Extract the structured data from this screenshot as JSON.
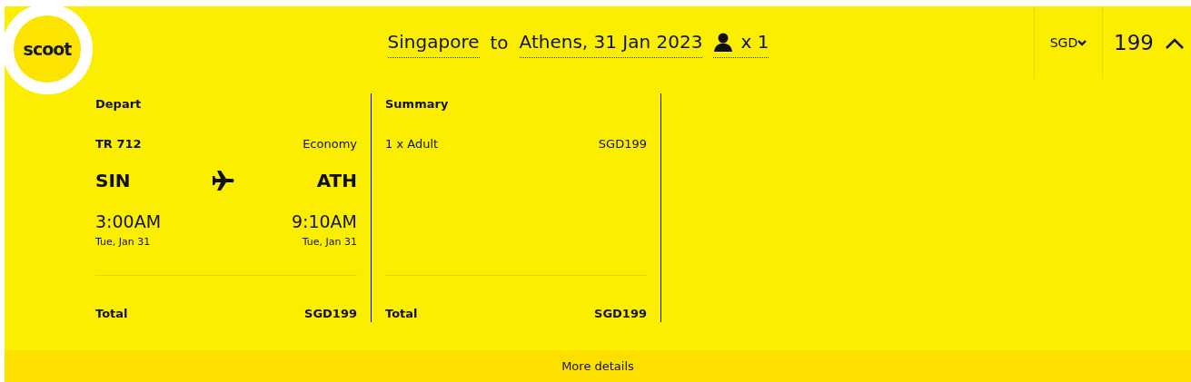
{
  "logo": {
    "text": "scoot"
  },
  "header": {
    "origin": "Singapore",
    "connector": "to",
    "destination_date": "Athens, 31 Jan 2023",
    "passengers": "x 1",
    "currency": "SGD",
    "price": "199",
    "expanded": true
  },
  "depart": {
    "title": "Depart",
    "flight": "TR 712",
    "cabin": "Economy",
    "from_code": "SIN",
    "to_code": "ATH",
    "depart_time": "3:00AM",
    "depart_date": "Tue, Jan 31",
    "arrive_time": "9:10AM",
    "arrive_date": "Tue, Jan 31",
    "total_label": "Total",
    "total": "SGD199"
  },
  "summary": {
    "title": "Summary",
    "lines": [
      {
        "label": "1 x Adult",
        "amount": "SGD199"
      }
    ],
    "total_label": "Total",
    "total": "SGD199"
  },
  "footer": {
    "link": "More details"
  }
}
